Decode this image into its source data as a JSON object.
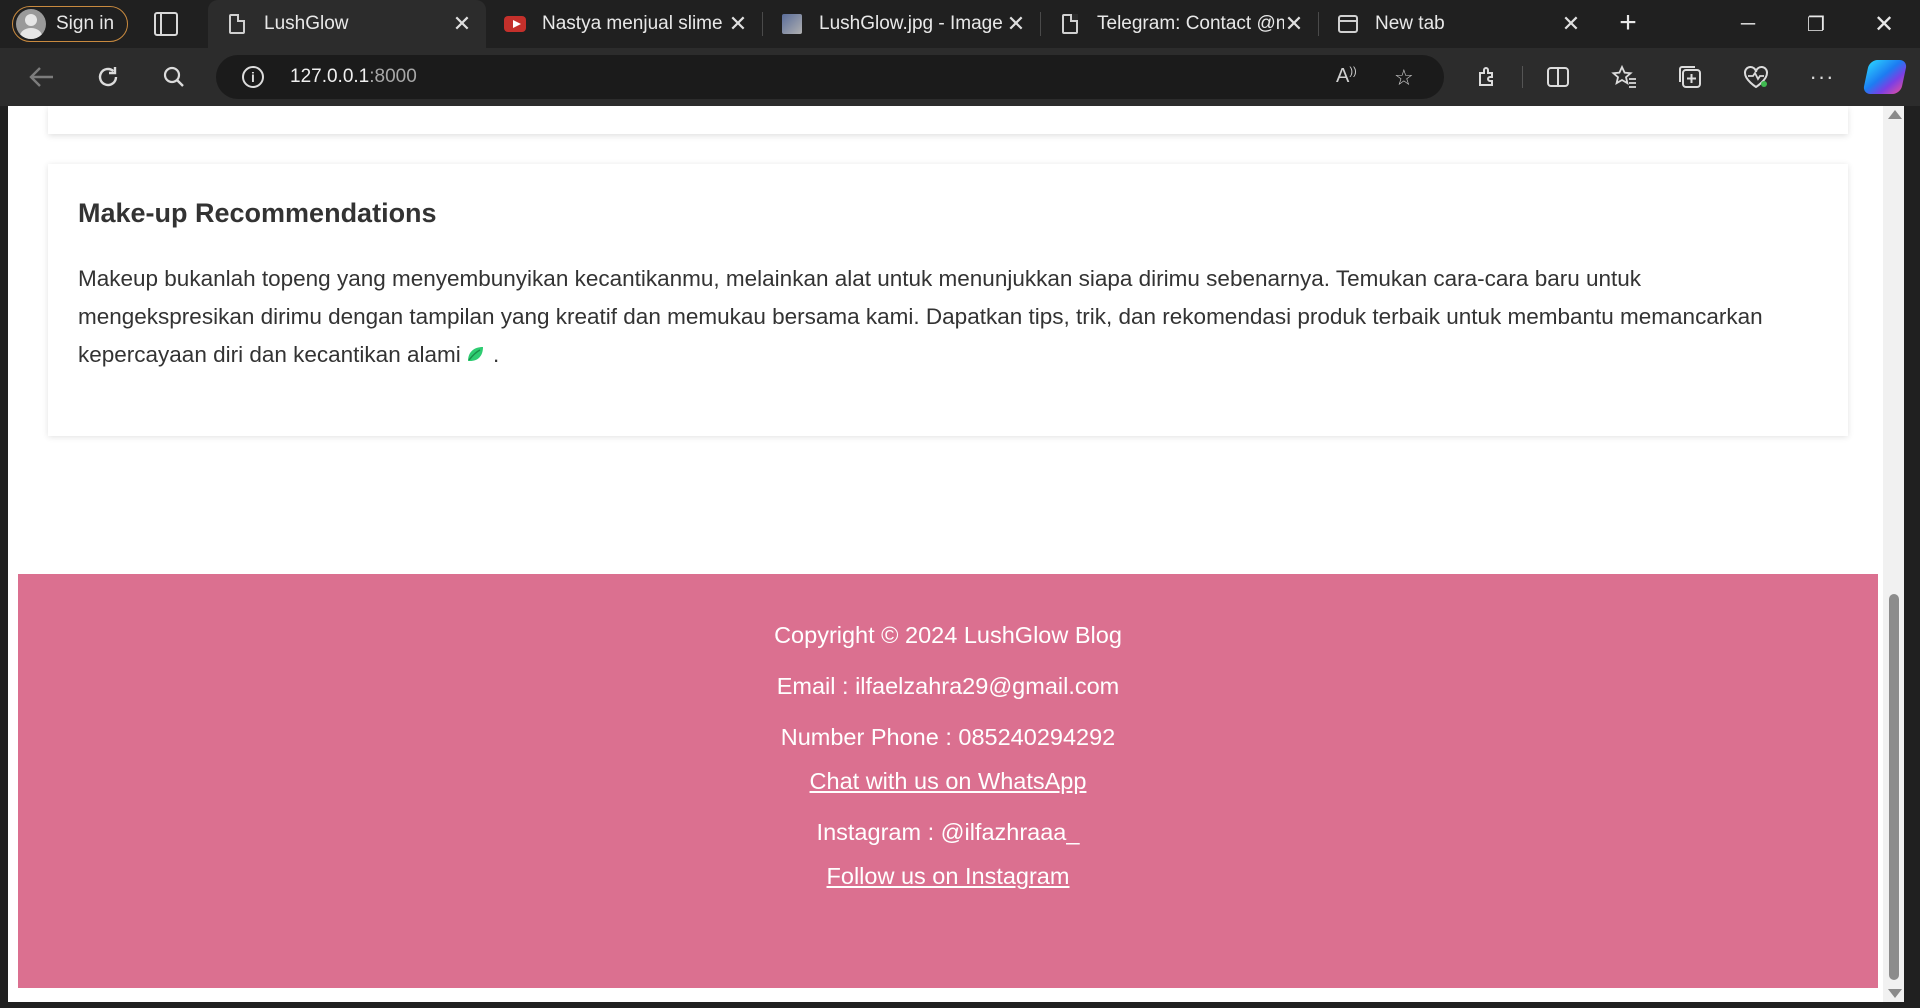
{
  "browser": {
    "profile": {
      "sign_in_label": "Sign in"
    },
    "tabs": [
      {
        "title": "LushGlow",
        "icon": "page-icon",
        "active": true
      },
      {
        "title": "Nastya menjual slime d",
        "icon": "youtube-icon",
        "active": false
      },
      {
        "title": "LushGlow.jpg - Image",
        "icon": "image-icon",
        "active": false
      },
      {
        "title": "Telegram: Contact @m",
        "icon": "page-icon",
        "active": false
      },
      {
        "title": "New tab",
        "icon": "new-tab-icon",
        "active": false
      }
    ],
    "address_bar": {
      "host": "127.0.0.1",
      "port": ":8000"
    }
  },
  "page": {
    "section": {
      "heading": "Make-up Recommendations",
      "body_before_emoji": "Makeup bukanlah topeng yang menyembunyikan kecantikanmu, melainkan alat untuk menunjukkan siapa dirimu sebenarnya. Temukan cara-cara baru untuk mengekspresikan dirimu dengan tampilan yang kreatif dan memukau bersama kami. Dapatkan tips, trik, dan rekomendasi produk terbaik untuk membantu memancarkan kepercayaan diri dan kecantikan alami",
      "emoji_icon": "leaf-icon",
      "body_after_emoji": " ."
    },
    "footer": {
      "copyright": "Copyright © 2024 LushGlow Blog",
      "email": "Email : ilfaelzahra29@gmail.com",
      "phone": "Number Phone : 085240294292",
      "whatsapp_link": "Chat with us on WhatsApp",
      "instagram": "Instagram : @ilfazhraaa_",
      "instagram_link": "Follow us on Instagram"
    }
  },
  "colors": {
    "footer_bg": "#db7090",
    "text": "#333333",
    "browser_chrome": "#202020"
  }
}
